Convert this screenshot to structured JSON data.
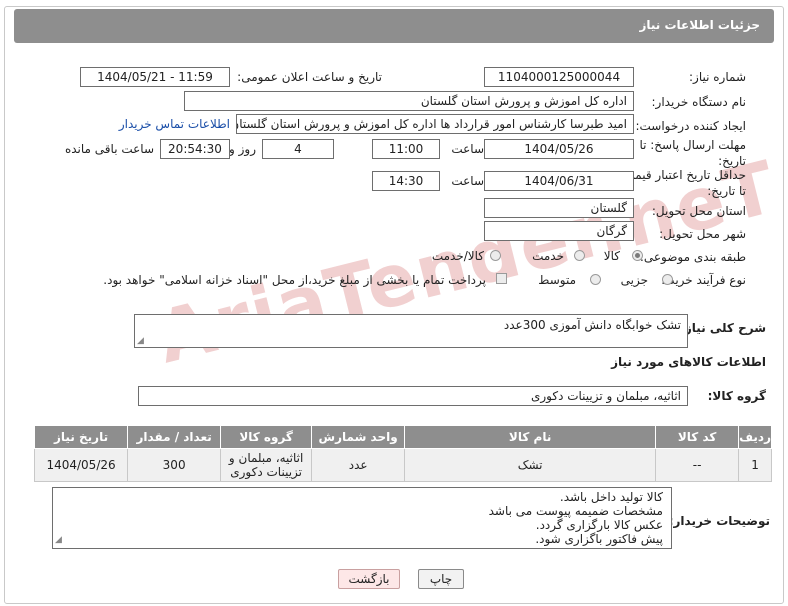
{
  "page": {
    "title": "جزئیات اطلاعات نیاز"
  },
  "watermark": "AriaTender.neT",
  "form": {
    "need_number": {
      "label": "شماره نیاز:",
      "value": "1104000125000044"
    },
    "announce_datetime": {
      "label": "تاریخ و ساعت اعلان عمومی:",
      "value": "1404/05/21 - 11:59"
    },
    "buyer_org": {
      "label": "نام دستگاه خریدار:",
      "value": "اداره کل اموزش و پرورش استان گلستان"
    },
    "requester": {
      "label": "ایجاد کننده درخواست:",
      "value": "امید طبرسا کارشناس امور قرارداد ها اداره کل اموزش و پرورش استان گلستان",
      "contact_link": "اطلاعات تماس خریدار"
    },
    "reply_deadline": {
      "label": "مهلت ارسال پاسخ: تا تاریخ:",
      "date": "1404/05/26",
      "time_label": "ساعت",
      "time": "11:00",
      "days": "4",
      "days_label": "روز و",
      "remaining": "20:54:30",
      "remaining_label": "ساعت باقی مانده"
    },
    "price_validity": {
      "label": "حداقل تاریخ اعتبار قیمت: تا تاریخ:",
      "date": "1404/06/31",
      "time_label": "ساعت",
      "time": "14:30"
    },
    "delivery_province": {
      "label": "استان محل تحویل:",
      "value": "گلستان"
    },
    "delivery_city": {
      "label": "شهر محل تحویل:",
      "value": "گرگان"
    },
    "category": {
      "label": "طبقه بندی موضوعی:",
      "options": [
        "کالا",
        "خدمت",
        "کالا/خدمت"
      ],
      "selected": "کالا"
    },
    "purchase_type": {
      "label": "نوع فرآیند خرید :",
      "options": [
        "جزیی",
        "متوسط"
      ],
      "checkbox_text": "پرداخت تمام یا بخشی از مبلغ خرید،از محل \"اسناد خزانه اسلامی\" خواهد بود."
    },
    "description": {
      "label": "شرح کلی نیاز:",
      "value": "تشک خوابگاه دانش آموزی 300عدد"
    }
  },
  "goods_section": {
    "heading": "اطلاعات کالاهای مورد نیاز",
    "group_label": "گروه کالا:",
    "group_value": "اثاثیه، مبلمان و تزیینات دکوری"
  },
  "table": {
    "headers": [
      "ردیف",
      "کد کالا",
      "نام کالا",
      "واحد شمارش",
      "گروه کالا",
      "تعداد / مقدار",
      "تاریخ نیاز"
    ],
    "rows": [
      {
        "row": "1",
        "code": "--",
        "name": "تشک",
        "unit": "عدد",
        "group": "اثاثیه، مبلمان و تزیینات دکوری",
        "qty": "300",
        "date": "1404/05/26"
      }
    ]
  },
  "buyer_notes": {
    "label": "توضیحات خریدار:",
    "lines": [
      "کالا تولید داخل باشد.",
      "مشخصات ضمیمه پیوست می باشد",
      "عکس کالا بارگزاری گردد.",
      "پیش فاکتور باگزاری شود."
    ]
  },
  "buttons": {
    "print": "چاپ",
    "back": "بازگشت"
  }
}
